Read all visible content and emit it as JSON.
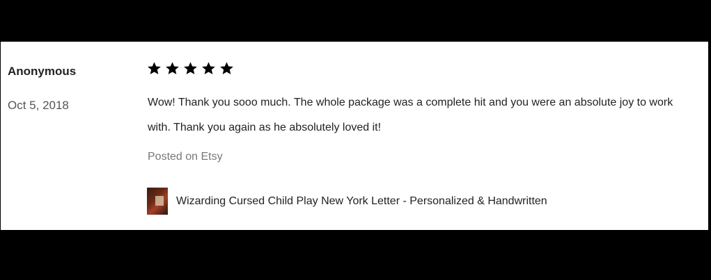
{
  "review": {
    "reviewer": "Anonymous",
    "date": "Oct 5, 2018",
    "rating": 5,
    "rating_max": 5,
    "text": "Wow! Thank you sooo much. The whole package was a complete hit and you were an absolute joy to work with. Thank you again as he absolutely loved it!",
    "source": "Posted on Etsy",
    "listing": {
      "title": "Wizarding Cursed Child Play New York Letter - Personalized & Handwritten",
      "thumbnail_icon": "listing-thumbnail"
    }
  },
  "colors": {
    "background": "#000000",
    "card": "#ffffff",
    "text": "#222222",
    "muted": "#777777",
    "star": "#000000"
  }
}
